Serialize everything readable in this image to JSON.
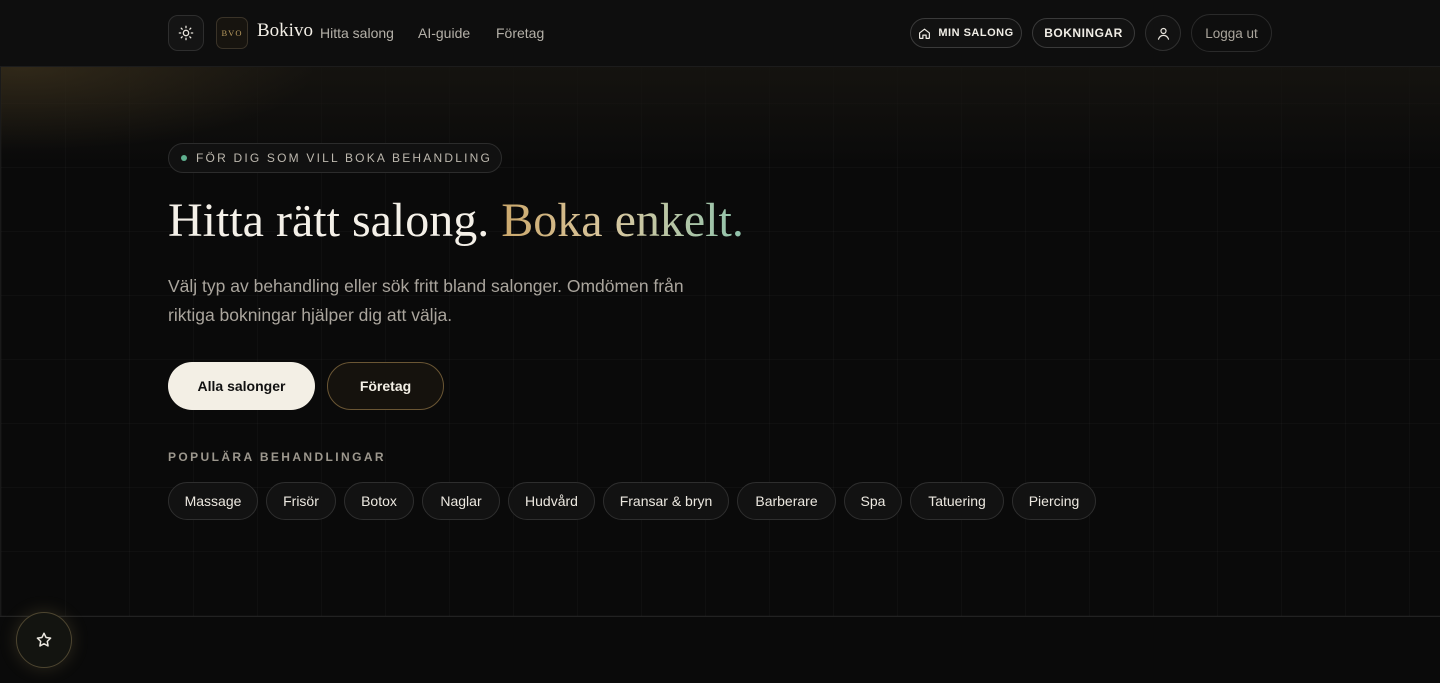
{
  "header": {
    "logo_text": "BVO",
    "brand": "Bokivo",
    "nav": [
      "Hitta salong",
      "AI-guide",
      "Företag"
    ],
    "min_salong_label": "MIN SALONG",
    "bokningar_label": "BOKNINGAR",
    "logout_label": "Logga ut"
  },
  "hero": {
    "eyebrow": "FÖR DIG SOM VILL BOKA BEHANDLING",
    "headline_part1": "Hitta rätt salong.",
    "headline_part2": "Boka enkelt.",
    "subtitle": "Välj typ av behandling eller sök fritt bland salonger. Omdömen från riktiga bokningar hjälper dig att välja.",
    "cta_primary": "Alla salonger",
    "cta_secondary": "Företag"
  },
  "popular": {
    "label": "POPULÄRA BEHANDLINGAR",
    "chips": [
      "Massage",
      "Frisör",
      "Botox",
      "Naglar",
      "Hudvård",
      "Fransar & bryn",
      "Barberare",
      "Spa",
      "Tatuering",
      "Piercing"
    ]
  },
  "colors": {
    "background": "#0b0b0b",
    "accent_gold": "#cba86c",
    "accent_teal": "#8fc3ac",
    "status_dot": "#5fb08f"
  },
  "icons": {
    "theme": "sun-icon",
    "min_salong": "home-icon",
    "user": "user-icon",
    "fab": "star-icon"
  }
}
